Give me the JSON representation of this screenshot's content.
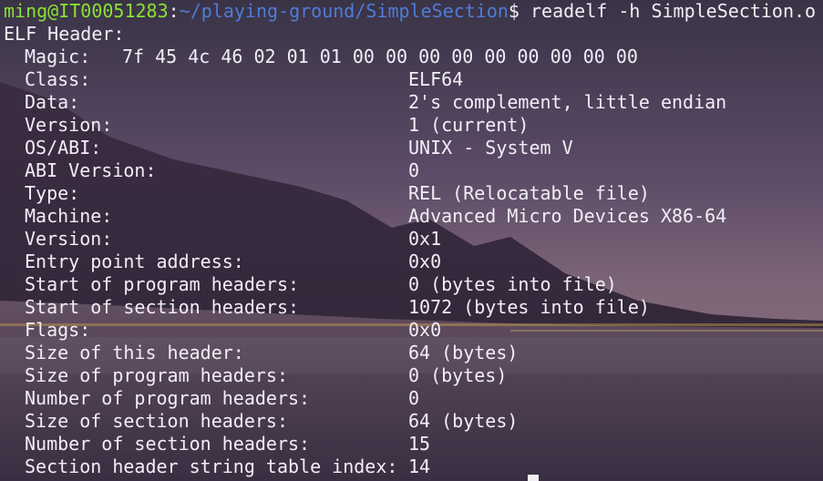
{
  "prompt": {
    "user_host": "ming@IT00051283",
    "colon": ":",
    "path": "~/playing-ground/SimpleSection",
    "dollar": "$",
    "command": " readelf -h SimpleSection.o"
  },
  "header_title": "ELF Header:",
  "magic": {
    "label": "Magic:",
    "value": "7f 45 4c 46 02 01 01 00 00 00 00 00 00 00 00 00"
  },
  "fields": [
    {
      "key": "Class:",
      "value": "ELF64"
    },
    {
      "key": "Data:",
      "value": "2's complement, little endian"
    },
    {
      "key": "Version:",
      "value": "1 (current)"
    },
    {
      "key": "OS/ABI:",
      "value": "UNIX - System V"
    },
    {
      "key": "ABI Version:",
      "value": "0"
    },
    {
      "key": "Type:",
      "value": "REL (Relocatable file)"
    },
    {
      "key": "Machine:",
      "value": "Advanced Micro Devices X86-64"
    },
    {
      "key": "Version:",
      "value": "0x1"
    },
    {
      "key": "Entry point address:",
      "value": "0x0"
    },
    {
      "key": "Start of program headers:",
      "value": "0 (bytes into file)"
    },
    {
      "key": "Start of section headers:",
      "value": "1072 (bytes into file)"
    },
    {
      "key": "Flags:",
      "value": "0x0"
    },
    {
      "key": "Size of this header:",
      "value": "64 (bytes)"
    },
    {
      "key": "Size of program headers:",
      "value": "0 (bytes)"
    },
    {
      "key": "Number of program headers:",
      "value": "0"
    },
    {
      "key": "Size of section headers:",
      "value": "64 (bytes)"
    },
    {
      "key": "Number of section headers:",
      "value": "15"
    },
    {
      "key": "Section header string table index:",
      "value": "14"
    }
  ],
  "colors": {
    "user_host": "#8ae234",
    "path": "#4e7cd6",
    "text": "#f2eef6"
  }
}
